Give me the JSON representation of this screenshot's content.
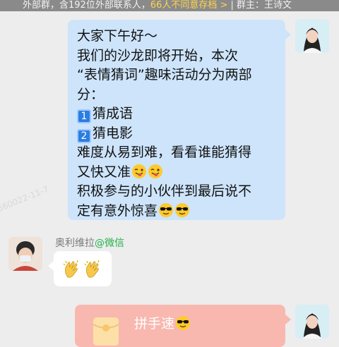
{
  "header": {
    "info_text": "外部群，含192位外部联系人，",
    "warning_text": "66人不同意存档 >",
    "owner_text": "| 群主：王诗文"
  },
  "watermark": {
    "text": "560022-11-7"
  },
  "messages": [
    {
      "side": "right",
      "bubble_color": "#cde4fb",
      "lines": [
        {
          "text": "大家下午好～"
        },
        {
          "text": "我们的沙龙即将开始，本次"
        },
        {
          "text": "“表情猜词”趣味活动分为两部"
        },
        {
          "text": "分："
        },
        {
          "keycap": "1",
          "text": "猜成语"
        },
        {
          "keycap": "2",
          "text": "猜电影"
        },
        {
          "text": "难度从易到难，看看谁能猜得"
        },
        {
          "text": "又快又准",
          "emojis": [
            "wink-tongue-emoji",
            "wink-tongue-emoji"
          ]
        },
        {
          "text": "积极参与的小伙伴到最后说不"
        },
        {
          "text": "定有意外惊喜",
          "emojis": [
            "sunglasses-emoji",
            "sunglasses-emoji"
          ]
        }
      ]
    },
    {
      "side": "left",
      "sender_name": "奥利维拉",
      "sender_source": "@微信",
      "emojis": [
        "clapping-hands-emoji",
        "clapping-hands-emoji"
      ]
    },
    {
      "side": "right",
      "type": "red_packet",
      "bubble_color": "#f8b8b0",
      "text": "拼手速",
      "emojis": [
        "sunglasses-emoji"
      ]
    }
  ]
}
